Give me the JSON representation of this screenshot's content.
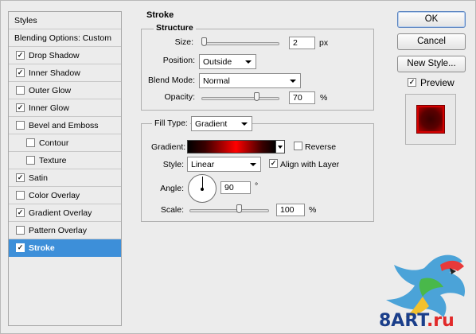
{
  "styles_list": {
    "items": [
      {
        "label": "Styles",
        "checkbox": false
      },
      {
        "label": "Blending Options: Custom",
        "checkbox": false
      },
      {
        "label": "Drop Shadow",
        "checkbox": true,
        "checked": true
      },
      {
        "label": "Inner Shadow",
        "checkbox": true,
        "checked": true
      },
      {
        "label": "Outer Glow",
        "checkbox": true,
        "checked": false
      },
      {
        "label": "Inner Glow",
        "checkbox": true,
        "checked": true
      },
      {
        "label": "Bevel and Emboss",
        "checkbox": true,
        "checked": false
      },
      {
        "label": "Contour",
        "checkbox": true,
        "checked": false
      },
      {
        "label": "Texture",
        "checkbox": true,
        "checked": false
      },
      {
        "label": "Satin",
        "checkbox": true,
        "checked": true
      },
      {
        "label": "Color Overlay",
        "checkbox": true,
        "checked": false
      },
      {
        "label": "Gradient Overlay",
        "checkbox": true,
        "checked": true
      },
      {
        "label": "Pattern Overlay",
        "checkbox": true,
        "checked": false
      },
      {
        "label": "Stroke",
        "checkbox": true,
        "checked": true,
        "selected": true
      }
    ]
  },
  "stroke": {
    "title": "Stroke",
    "structure": {
      "legend": "Structure",
      "size_label": "Size:",
      "size_value": "2",
      "size_unit": "px",
      "position_label": "Position:",
      "position_value": "Outside",
      "blend_mode_label": "Blend Mode:",
      "blend_mode_value": "Normal",
      "opacity_label": "Opacity:",
      "opacity_value": "70",
      "opacity_unit": "%"
    },
    "fill": {
      "fill_type_label": "Fill Type:",
      "fill_type_value": "Gradient",
      "gradient_label": "Gradient:",
      "reverse_label": "Reverse",
      "reverse_checked": false,
      "style_label": "Style:",
      "style_value": "Linear",
      "align_label": "Align with Layer",
      "align_checked": true,
      "angle_label": "Angle:",
      "angle_value": "90",
      "angle_unit": "°",
      "scale_label": "Scale:",
      "scale_value": "100",
      "scale_unit": "%"
    }
  },
  "buttons": {
    "ok": "OK",
    "cancel": "Cancel",
    "new_style": "New Style...",
    "preview_label": "Preview",
    "preview_checked": true
  },
  "watermark": {
    "text_prefix": "8ART",
    "text_suffix": ".ru"
  },
  "colors": {
    "selection": "#3d8fd9",
    "accent_red": "#ff0000"
  },
  "icons": [
    "checkmark-icon",
    "dropdown-arrow-icon",
    "angle-dial-icon",
    "parrot-logo-icon"
  ]
}
